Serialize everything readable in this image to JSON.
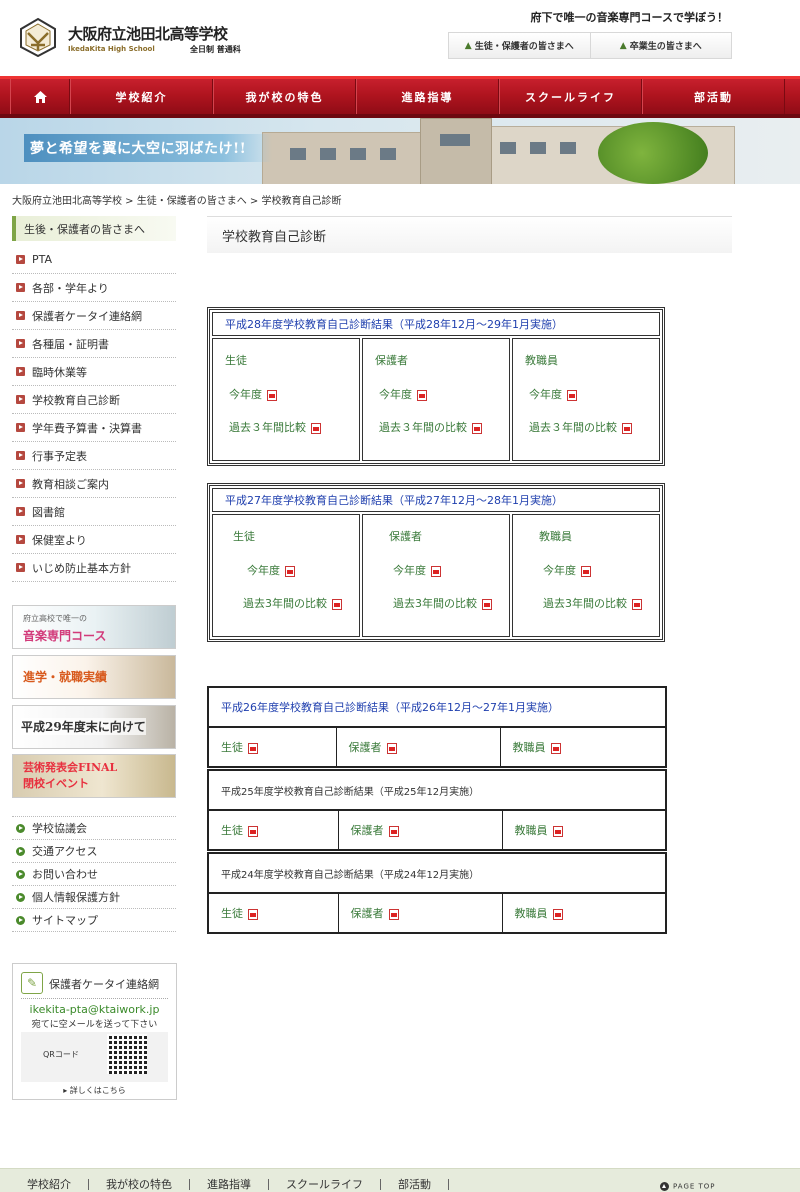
{
  "header": {
    "school_name": "大阪府立池田北高等学校",
    "school_name_en": "IkedaKita High School",
    "school_type": "全日制 普通科",
    "catchphrase": "府下で唯一の音楽専門コースで学ぼう！",
    "btn_parents": "生徒・保護者の皆さまへ",
    "btn_alumni": "卒業生の皆さまへ"
  },
  "gnav": [
    "学校紹介",
    "我が校の特色",
    "進路指導",
    "スクールライフ",
    "部活動"
  ],
  "banner": {
    "text": "夢と希望を翼に大空に羽ばたけ!!"
  },
  "breadcrumb": {
    "c1": "大阪府立池田北高等学校",
    "sep": " > ",
    "c2": "生徒・保護者の皆さまへ",
    "c3": "学校教育自己診断"
  },
  "sidebar": {
    "heading": "生後・保護者の皆さまへ",
    "items": [
      "PTA",
      "各部・学年より",
      "保護者ケータイ連絡網",
      "各種届・証明書",
      "臨時休業等",
      "学校教育自己診断",
      "学年費予算書・決算書",
      "行事予定表",
      "教育相談ご案内",
      "図書館",
      "保健室より",
      "いじめ防止基本方針"
    ],
    "banners": {
      "music_sub": "府立高校で唯一の",
      "music_main": "音楽専門コース",
      "career": "進学・就職実績",
      "h29": "平成29年度末に向けて",
      "event1": "芸術発表会FINAL",
      "event2": "閉校イベント"
    },
    "links": [
      "学校協議会",
      "交通アクセス",
      "お問い合わせ",
      "個人情報保護方針",
      "サイトマップ"
    ],
    "mobile": {
      "title": "保護者ケータイ連絡網",
      "email": "ikekita-pta@ktaiwork.jp",
      "note": "宛てに空メールを送って下さい",
      "qr_label": "QRコード",
      "more": "▸ 詳しくはこちら"
    }
  },
  "main": {
    "title": "学校教育自己診断",
    "h28": {
      "caption": "平成28年度学校教育自己診断結果（平成28年12月～29年1月実施）",
      "cols": [
        {
          "name": "生徒",
          "this_year": "今年度",
          "compare": "過去３年間比較"
        },
        {
          "name": "保護者",
          "this_year": "今年度",
          "compare": "過去３年間の比較"
        },
        {
          "name": "教職員",
          "this_year": "今年度",
          "compare": "過去３年間の比較"
        }
      ]
    },
    "h27": {
      "caption": "平成27年度学校教育自己診断結果（平成27年12月～28年1月実施）",
      "cols": [
        {
          "name": "生徒",
          "this_year": "今年度",
          "compare": "過去3年間の比較"
        },
        {
          "name": "保護者",
          "this_year": "今年度",
          "compare": "過去3年間の比較"
        },
        {
          "name": "教職員",
          "this_year": "今年度",
          "compare": "過去3年間の比較"
        }
      ]
    },
    "h26": {
      "caption": "平成26年度学校教育自己診断結果（平成26年12月～27年1月実施）",
      "cols": [
        "生徒",
        "保護者",
        "教職員"
      ]
    },
    "h25": {
      "caption": "平成25年度学校教育自己診断結果（平成25年12月実施）",
      "cols": [
        "生徒",
        "保護者",
        "教職員"
      ]
    },
    "h24": {
      "caption": "平成24年度学校教育自己診断結果（平成24年12月実施）",
      "cols": [
        "生徒",
        "保護者",
        "教職員"
      ]
    }
  },
  "footer": {
    "nav": [
      "学校紹介",
      "我が校の特色",
      "進路指導",
      "スクールライフ",
      "部活動"
    ],
    "pagetop": "PAGE TOP"
  }
}
